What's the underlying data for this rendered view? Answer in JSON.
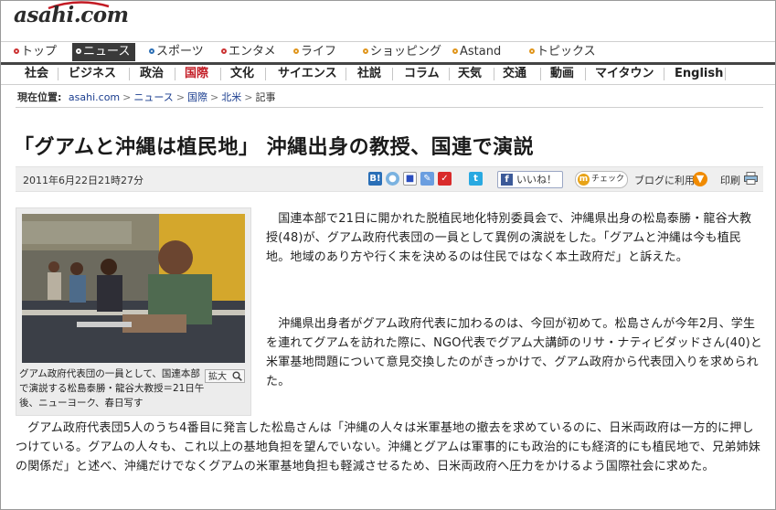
{
  "site": {
    "logo": "asahi.com"
  },
  "nav_primary": [
    {
      "label": "トップ",
      "style": "red"
    },
    {
      "label": "ニュース",
      "style": "active"
    },
    {
      "label": "スポーツ",
      "style": "blue"
    },
    {
      "label": "エンタメ",
      "style": "red"
    },
    {
      "label": "ライフ",
      "style": "orange"
    },
    {
      "label": "ショッピング",
      "style": "orange"
    },
    {
      "label": "Astand",
      "style": "orange"
    },
    {
      "label": "トピックス",
      "style": "orange"
    }
  ],
  "nav_secondary": [
    "社会",
    "ビジネス",
    "政治",
    "国際",
    "文化",
    "サイエンス",
    "社説",
    "コラム",
    "天気",
    "交通",
    "動画",
    "マイタウン",
    "English"
  ],
  "nav_secondary_active": "国際",
  "breadcrumb": {
    "label": "現在位置:",
    "items": [
      "asahi.com",
      "ニュース",
      "国際",
      "北米",
      "記事"
    ]
  },
  "article": {
    "headline": "「グアムと沖縄は植民地」 沖縄出身の教授、国連で演説",
    "date": "2011年6月22日21時27分",
    "like_button": "いいね！",
    "check_button": "チェック",
    "blog_label": "ブログに利用",
    "print_label": "印刷",
    "photo_caption": "グアム政府代表団の一員として、国連本部で演説する松島泰勝・龍谷大教授＝21日午後、ニューヨーク、春日写す",
    "zoom_label": "拡大",
    "paragraphs": [
      "国連本部で21日に開かれた脱植民地化特別委員会で、沖縄県出身の松島泰勝・龍谷大教授(48)が、グアム政府代表団の一員として異例の演説をした。「グアムと沖縄は今も植民地。地域のあり方や行く末を決めるのは住民ではなく本土政府だ」と訴えた。",
      "沖縄県出身者がグアム政府代表に加わるのは、今回が初めて。松島さんが今年2月、学生を連れてグアムを訪れた際に、NGO代表でグアム大講師のリサ・ナティビダッドさん(40)と米軍基地問題について意見交換したのがきっかけで、グアム政府から代表団入りを求められた。",
      "グアム政府代表団5人のうち4番目に発言した松島さんは「沖縄の人々は米軍基地の撤去を求めているのに、日米両政府は一方的に押しつけている。グアムの人々も、これ以上の基地負担を望んでいない。沖縄とグアムは軍事的にも政治的にも経済的にも植民地で、兄弟姉妹の関係だ」と述べ、沖縄だけでなくグアムの米軍基地負担も軽減させるため、日米両政府へ圧力をかけるよう国際社会に求めた。"
    ]
  },
  "colors": {
    "accent_red": "#c31b24",
    "nav_dark": "#3a3a3a",
    "facebook": "#3b5998"
  }
}
